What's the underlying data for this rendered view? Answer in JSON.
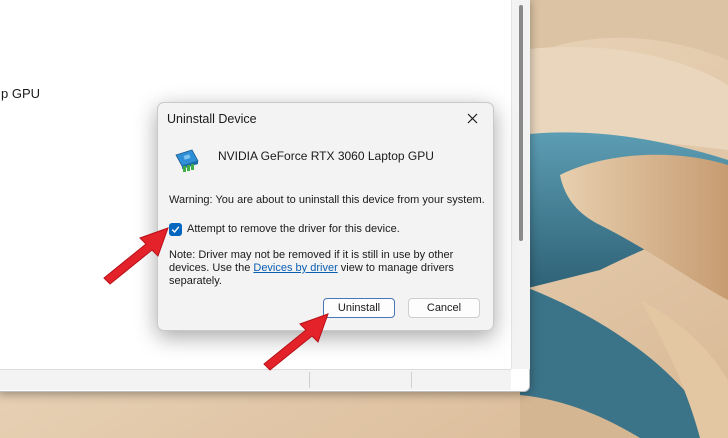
{
  "device_manager": {
    "list_item_visible": "p GPU"
  },
  "dialog": {
    "title": "Uninstall Device",
    "device_name": "NVIDIA GeForce RTX 3060 Laptop GPU",
    "warning": "Warning: You are about to uninstall this device from your system.",
    "checkbox": {
      "label": "Attempt to remove the driver for this device.",
      "checked": true
    },
    "note": {
      "before_link": "Note: Driver may not be removed if it is still in use by other devices. Use the ",
      "link": "Devices by driver",
      "after_link": " view to manage drivers separately."
    },
    "buttons": {
      "uninstall": "Uninstall",
      "cancel": "Cancel"
    }
  },
  "icons": {
    "close": "close-icon",
    "device": "gpu-card-icon",
    "check": "check-icon"
  },
  "colors": {
    "accent": "#0067c0",
    "link": "#0a5fb4",
    "annotation_arrow": "#e3222a",
    "dialog_bg": "#f3f3f3"
  }
}
